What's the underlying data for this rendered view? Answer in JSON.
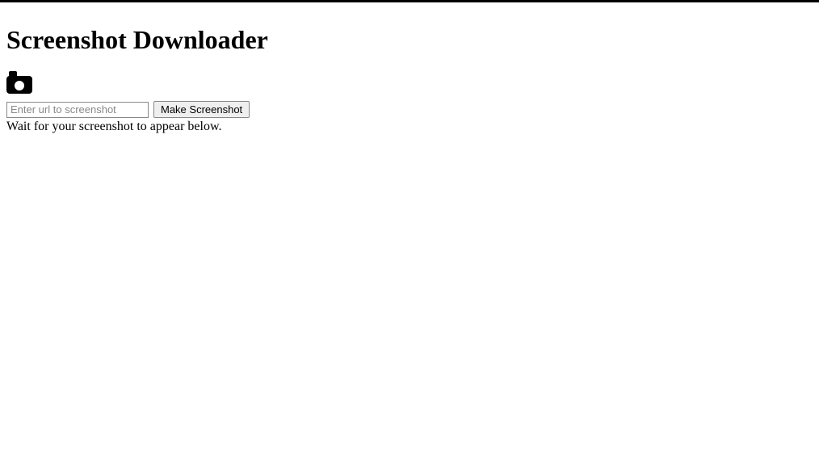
{
  "header": {
    "title": "Screenshot Downloader"
  },
  "form": {
    "url_placeholder": "Enter url to screenshot",
    "url_value": "",
    "submit_label": "Make Screenshot"
  },
  "status": {
    "message": "Wait for your screenshot to appear below."
  }
}
